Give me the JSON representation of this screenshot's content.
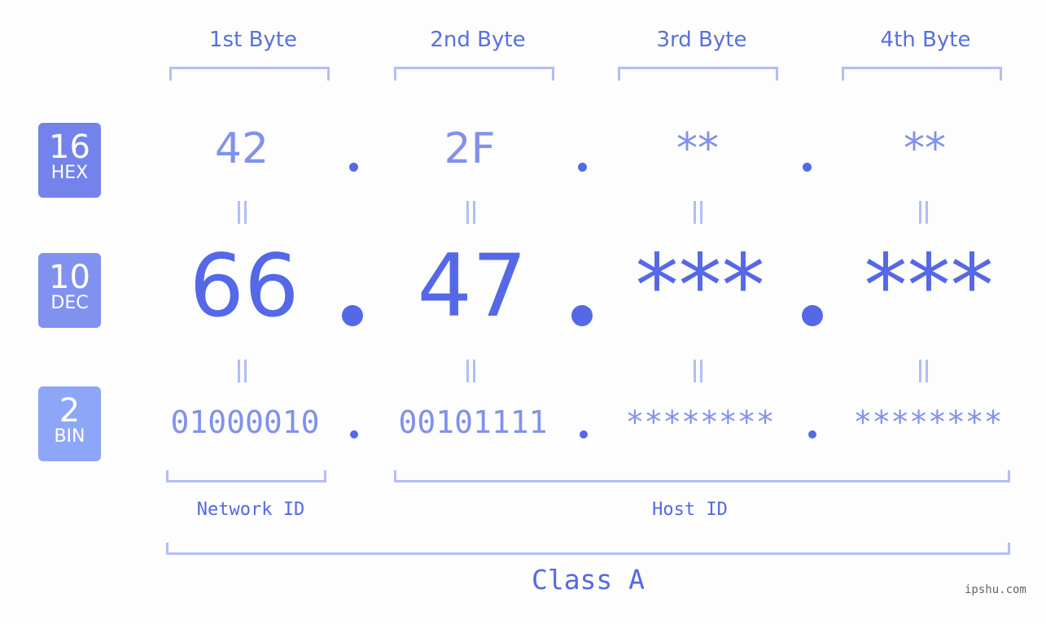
{
  "headers": [
    "1st Byte",
    "2nd Byte",
    "3rd Byte",
    "4th Byte"
  ],
  "badges": [
    {
      "num": "16",
      "label": "HEX",
      "color": "#7383eb"
    },
    {
      "num": "10",
      "label": "DEC",
      "color": "#8191ef"
    },
    {
      "num": "2",
      "label": "BIN",
      "color": "#8ea6f7"
    }
  ],
  "hex": [
    "42",
    "2F",
    "**",
    "**"
  ],
  "dec": [
    "66",
    "47",
    "***",
    "***"
  ],
  "bin": [
    "01000010",
    "00101111",
    "********",
    "********"
  ],
  "separator": ".",
  "network_label": "Network ID",
  "host_label": "Host ID",
  "class_label": "Class A",
  "watermark": "ipshu.com"
}
